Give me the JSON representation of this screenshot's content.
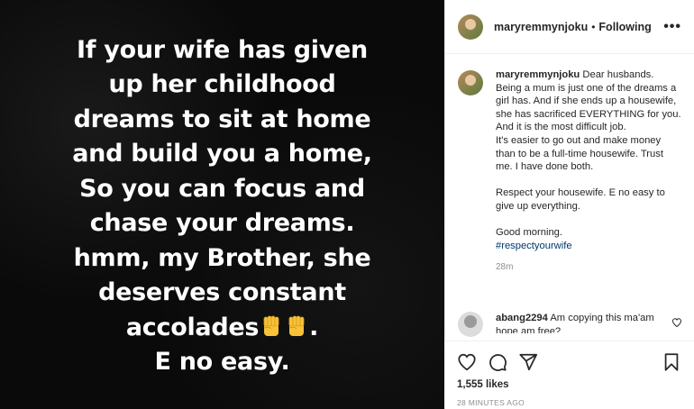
{
  "post": {
    "quote_lines": [
      "If your wife has given",
      "up her childhood",
      "dreams to sit at home",
      "and build you a home,",
      "So you can focus and",
      "chase your dreams.",
      "hmm, my Brother, she",
      "deserves constant",
      "accolades",
      "E no easy."
    ],
    "emoji": "raised-fist-icon"
  },
  "header": {
    "username": "maryremmynjoku",
    "separator": "•",
    "follow_status": "Following",
    "more_label": "•••"
  },
  "caption": {
    "username": "maryremmynjoku",
    "paragraph1": "Dear husbands. Being a mum is just one of the dreams a girl has. And if she ends up a housewife, she has sacrificed EVERYTHING for you.",
    "line2": "And it is the most difficult job.",
    "line3": "It's easier to go out and make money than to be a full-time housewife. Trust me. I have done both.",
    "paragraph2": "Respect your housewife. E no easy to give up everything.",
    "greeting": "Good morning.",
    "hashtag": "#respectyourwife",
    "time": "28m"
  },
  "comment": {
    "username": "abang2294",
    "text": "Am copying this ma'am hope am free?"
  },
  "actions": {
    "likes": "1,555 likes",
    "posted": "28 MINUTES AGO"
  }
}
